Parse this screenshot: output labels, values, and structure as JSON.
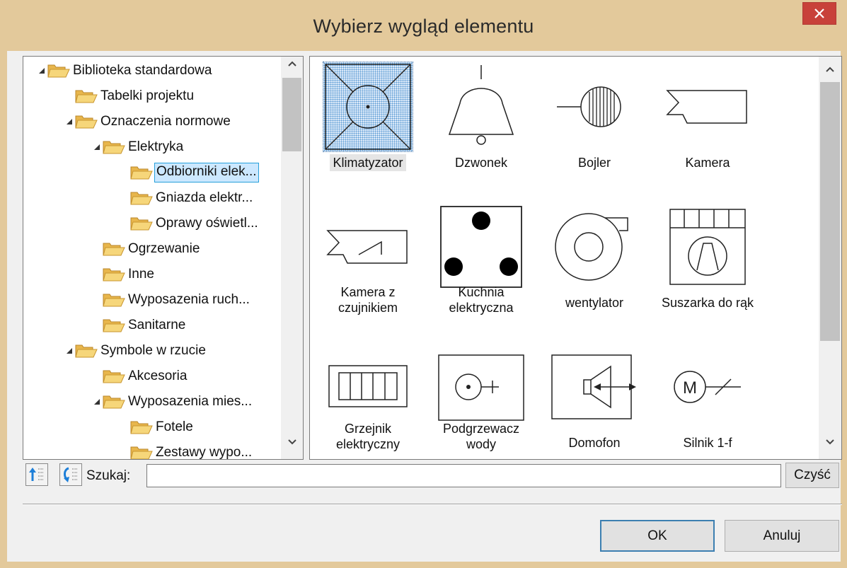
{
  "window": {
    "title": "Wybierz wygląd elementu",
    "close_icon": "close-icon"
  },
  "tree": {
    "items": [
      {
        "label": "Biblioteka standardowa",
        "level": 0,
        "expanded": true
      },
      {
        "label": "Tabelki projektu",
        "level": 1,
        "expanded": null
      },
      {
        "label": "Oznaczenia normowe",
        "level": 1,
        "expanded": true
      },
      {
        "label": "Elektryka",
        "level": 2,
        "expanded": true
      },
      {
        "label": "Odbiorniki elek...",
        "level": 3,
        "expanded": null,
        "selected": true
      },
      {
        "label": "Gniazda elektr...",
        "level": 3,
        "expanded": null
      },
      {
        "label": "Oprawy oświetl...",
        "level": 3,
        "expanded": null
      },
      {
        "label": "Ogrzewanie",
        "level": 2,
        "expanded": null
      },
      {
        "label": "Inne",
        "level": 2,
        "expanded": null
      },
      {
        "label": "Wyposazenia ruch...",
        "level": 2,
        "expanded": null
      },
      {
        "label": "Sanitarne",
        "level": 2,
        "expanded": null
      },
      {
        "label": "Symbole w rzucie",
        "level": 1,
        "expanded": true
      },
      {
        "label": "Akcesoria",
        "level": 2,
        "expanded": null
      },
      {
        "label": "Wyposazenia mies...",
        "level": 2,
        "expanded": true
      },
      {
        "label": "Fotele",
        "level": 3,
        "expanded": null
      },
      {
        "label": "Zestawy wypo...",
        "level": 3,
        "expanded": null
      }
    ]
  },
  "symbols": [
    {
      "label": "Klimatyzator",
      "selected": true
    },
    {
      "label": "Dzwonek"
    },
    {
      "label": "Bojler"
    },
    {
      "label": "Kamera"
    },
    {
      "label": "Kamera z\nczujnikiem"
    },
    {
      "label": "Kuchnia\nelektryczna"
    },
    {
      "label": "wentylator"
    },
    {
      "label": "Suszarka do rąk"
    },
    {
      "label": "Grzejnik\nelektryczny"
    },
    {
      "label": "Podgrzewacz\nwody"
    },
    {
      "label": "Domofon"
    },
    {
      "label": "Silnik 1-f"
    }
  ],
  "search": {
    "label": "Szukaj:",
    "value": "",
    "clear_label": "Czyść"
  },
  "buttons": {
    "ok": "OK",
    "cancel": "Anuluj"
  },
  "symbol_text": {
    "motor_letter": "M"
  }
}
